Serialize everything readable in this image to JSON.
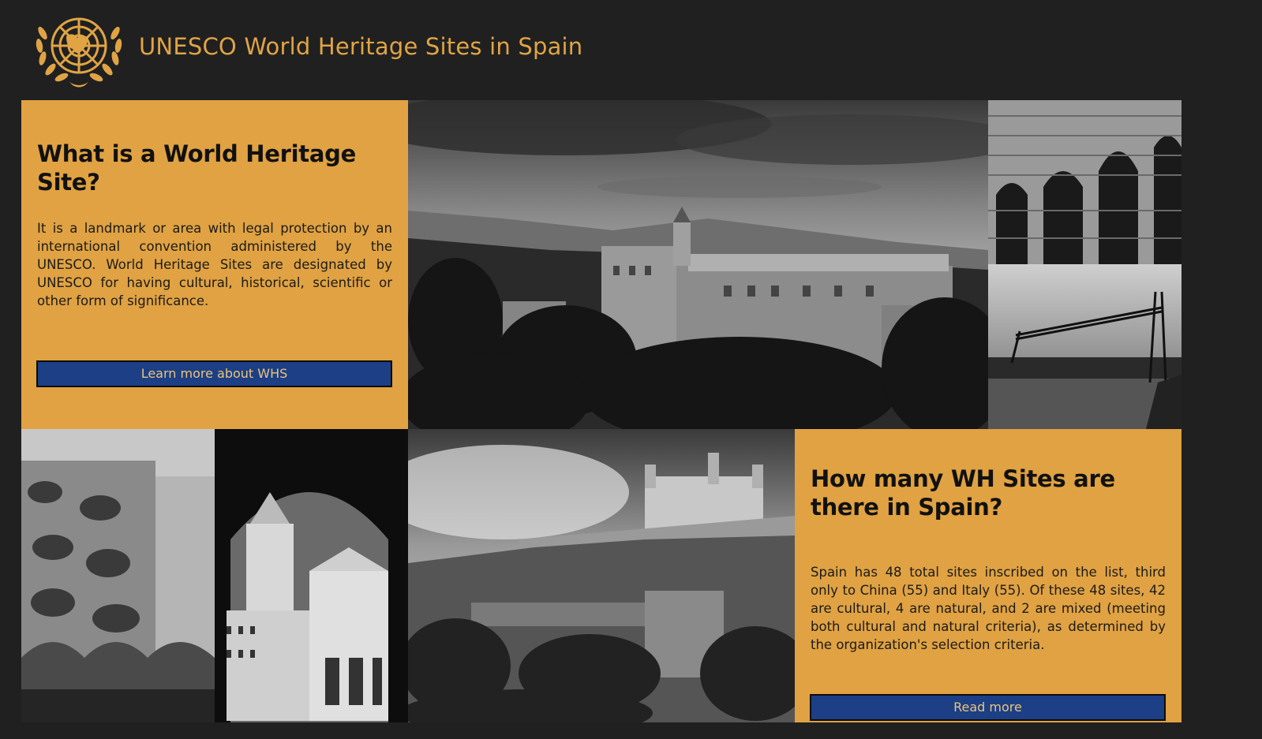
{
  "header": {
    "title": "UNESCO World Heritage Sites in Spain",
    "logo_icon": "un-emblem-icon"
  },
  "panels": {
    "what": {
      "heading": "What is a World Heritage Site?",
      "body": "It is a landmark or area with legal protection by an international convention administered by the UNESCO. World Heritage Sites are designated by UNESCO for having cultural, historical, scientific or other form of significance.",
      "button": "Learn more about WHS"
    },
    "how_many": {
      "heading": "How many WH Sites are there in Spain?",
      "body": "Spain has 48 total sites inscribed on the list, third only to China (55) and Italy (55). Of these 48 sites, 42 are cultural, 4 are natural, and 2 are mixed (meeting both cultural and natural criteria), as determined by the organization's selection criteria.",
      "button": "Read more"
    }
  },
  "images": {
    "alhambra": "alhambra-photo",
    "aqueduct": "aqueduct-segovia-photo",
    "bridge": "vizcaya-bridge-photo",
    "casa_batllo": "casa-batllo-photo",
    "escorial": "el-escorial-photo",
    "toledo": "toledo-photo"
  },
  "colors": {
    "background": "#202020",
    "accent": "#e0a242",
    "button": "#1c3f86",
    "button_text": "#e9c47b"
  }
}
